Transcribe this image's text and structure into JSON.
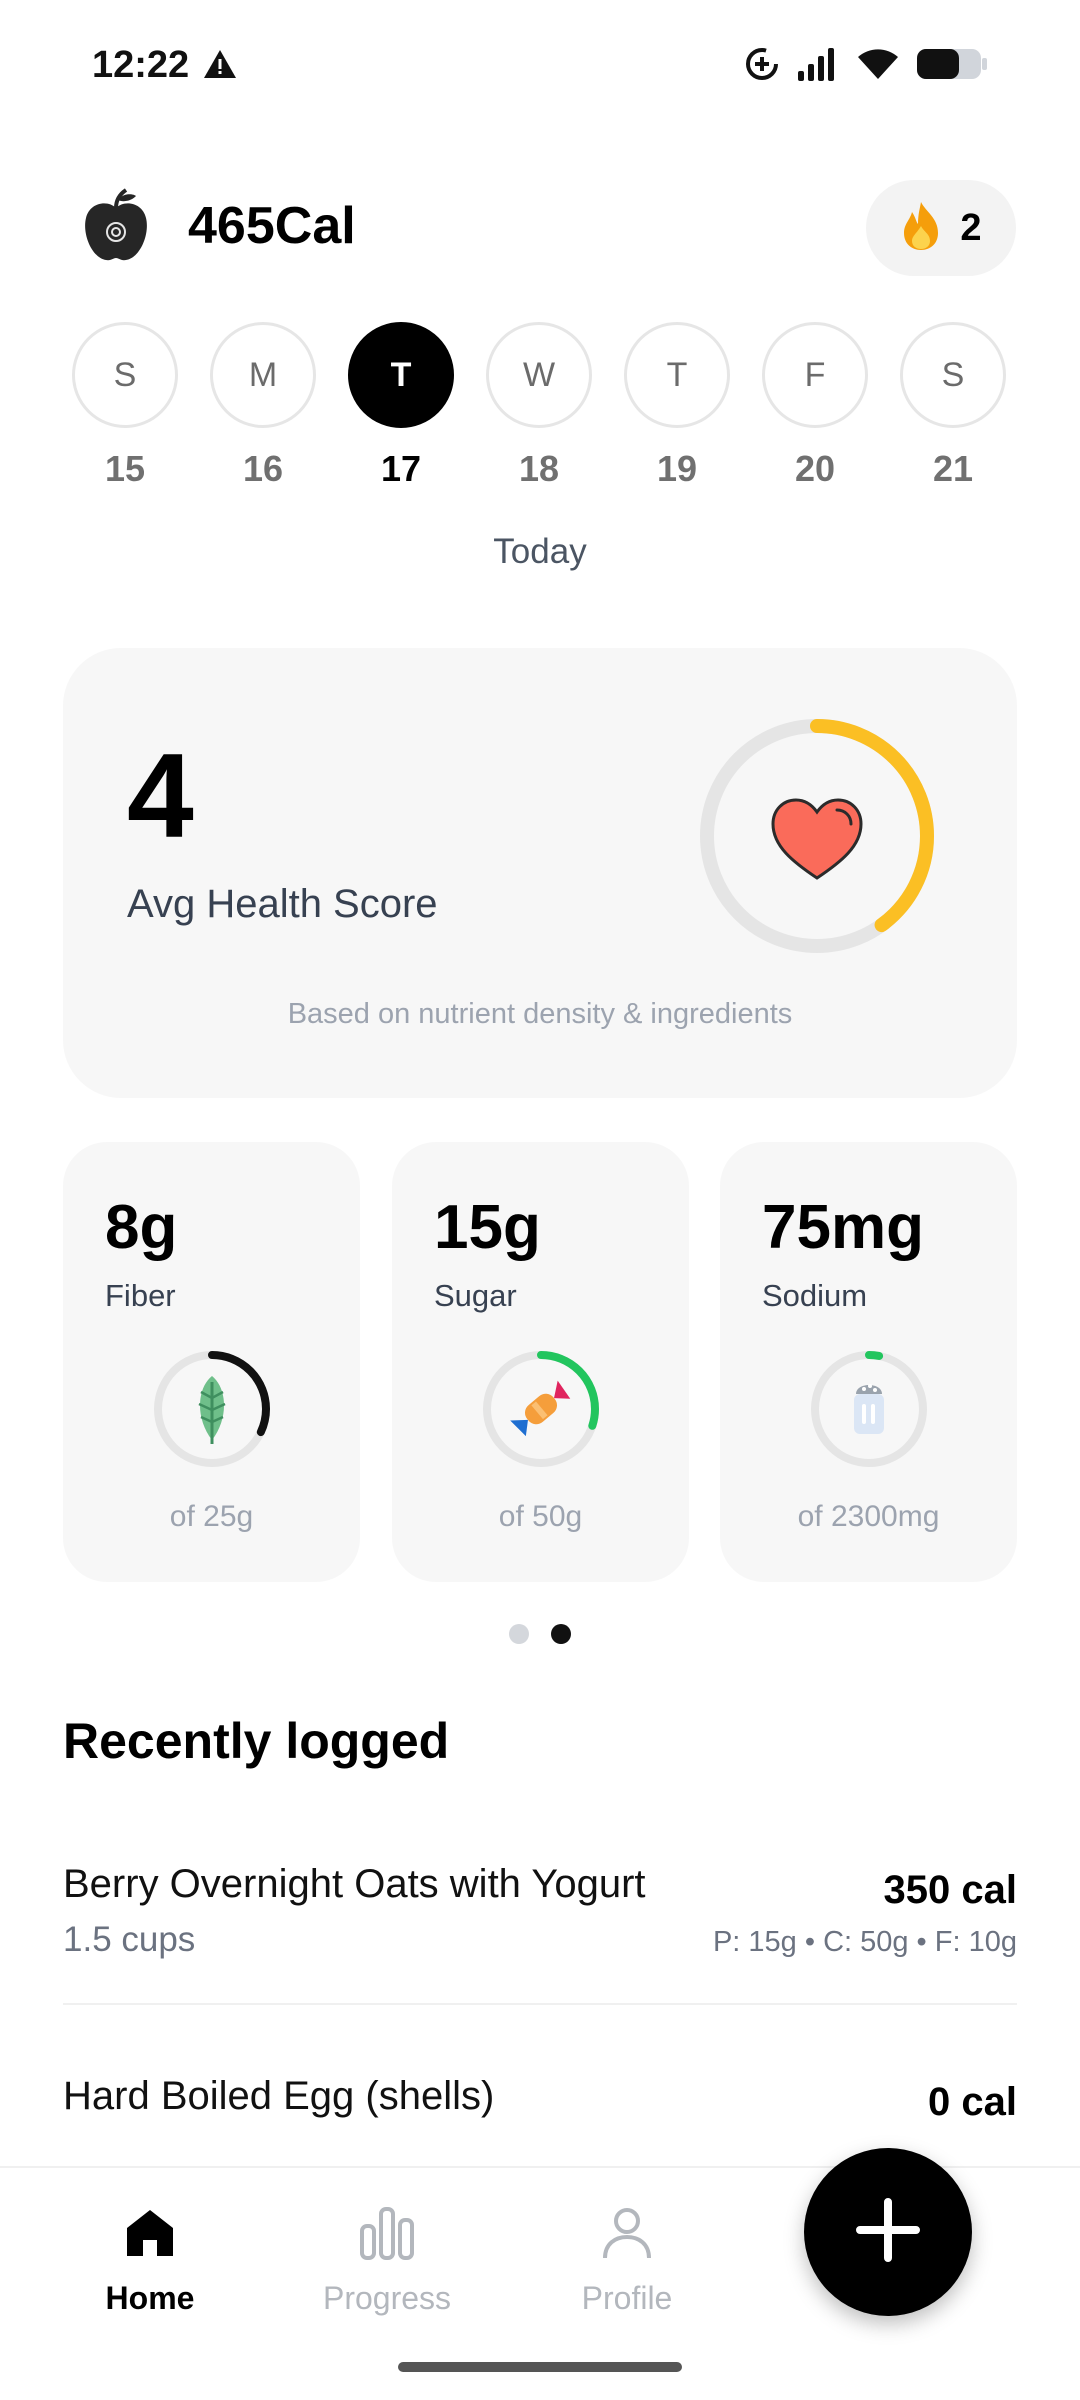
{
  "status_bar": {
    "time": "12:22"
  },
  "header": {
    "app_name": "465Cal",
    "streak_count": "2"
  },
  "week": {
    "days": [
      {
        "letter": "S",
        "date": "15",
        "active": false
      },
      {
        "letter": "M",
        "date": "16",
        "active": false
      },
      {
        "letter": "T",
        "date": "17",
        "active": true
      },
      {
        "letter": "W",
        "date": "18",
        "active": false
      },
      {
        "letter": "T",
        "date": "19",
        "active": false
      },
      {
        "letter": "F",
        "date": "20",
        "active": false
      },
      {
        "letter": "S",
        "date": "21",
        "active": false
      }
    ],
    "selected_label": "Today"
  },
  "health": {
    "score": "4",
    "label": "Avg Health Score",
    "note": "Based on nutrient density & ingredients",
    "ring_fraction": 0.4,
    "ring_color": "#fbbf24"
  },
  "nutrients": [
    {
      "value": "8g",
      "label": "Fiber",
      "goal": "of 25g",
      "fraction": 0.32,
      "ring_color": "#111111",
      "icon": "fiber-leaf-icon"
    },
    {
      "value": "15g",
      "label": "Sugar",
      "goal": "of 50g",
      "fraction": 0.3,
      "ring_color": "#22c55e",
      "icon": "candy-icon"
    },
    {
      "value": "75mg",
      "label": "Sodium",
      "goal": "of 2300mg",
      "fraction": 0.03,
      "ring_color": "#22c55e",
      "icon": "salt-shaker-icon"
    }
  ],
  "pager": {
    "count": 2,
    "active_index": 1
  },
  "recent": {
    "title": "Recently logged",
    "items": [
      {
        "name": "Berry Overnight Oats with Yogurt",
        "serving": "1.5 cups",
        "calories": "350 cal",
        "macros": "P: 15g • C: 50g • F: 10g"
      },
      {
        "name": "Hard Boiled Egg (shells)",
        "calories": "0 cal"
      }
    ]
  },
  "nav": {
    "home": "Home",
    "progress": "Progress",
    "profile": "Profile"
  },
  "colors": {
    "accent": "#000000",
    "flame": "#f59e0b",
    "heart": "#fa6b5a"
  }
}
